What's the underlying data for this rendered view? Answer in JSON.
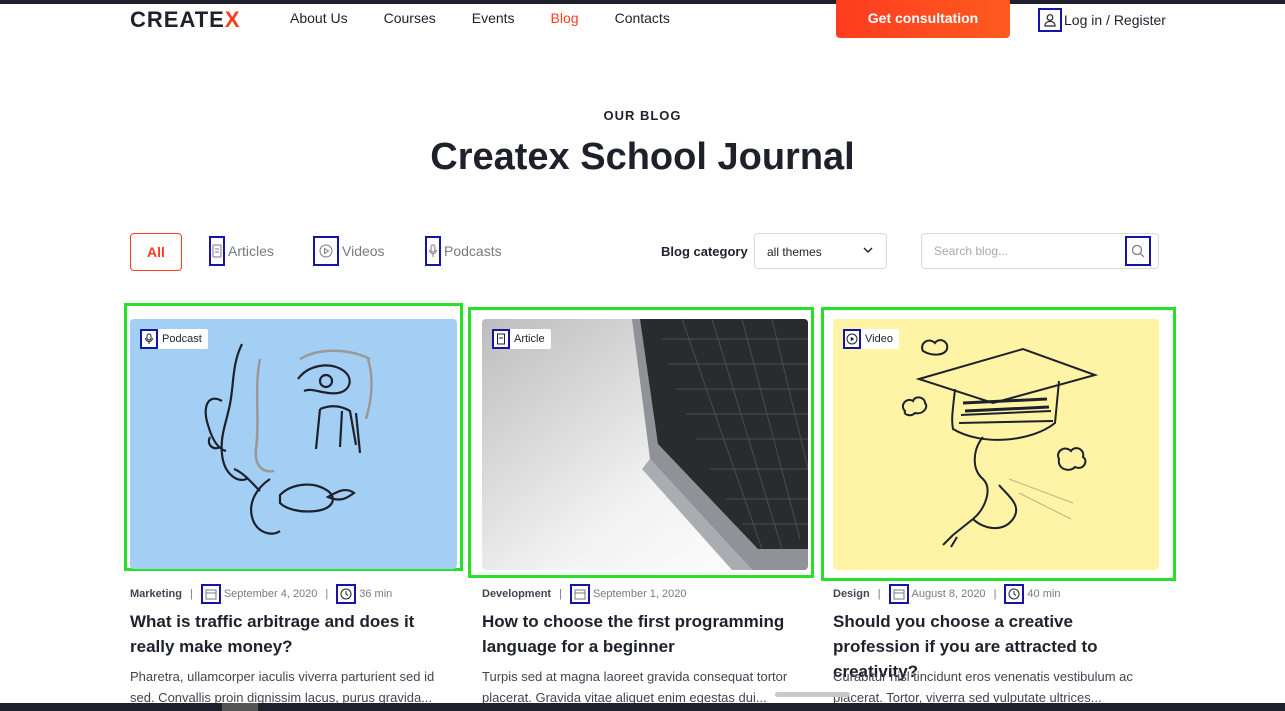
{
  "header": {
    "logo_main": "CREATE",
    "logo_accent": "X",
    "nav": [
      "About Us",
      "Courses",
      "Events",
      "Blog",
      "Contacts"
    ],
    "active_nav": "Blog",
    "consult_button": "Get consultation",
    "login": "Log in / Register",
    "user_icon": "user-icon"
  },
  "hero": {
    "eyebrow": "OUR BLOG",
    "title": "Createx School Journal"
  },
  "filters": {
    "all": "All",
    "articles": "Articles",
    "videos": "Videos",
    "podcasts": "Podcasts",
    "category_label": "Blog category",
    "category_value": "all themes",
    "search_placeholder": "Search blog..."
  },
  "cards": [
    {
      "badge": "Podcast",
      "badge_icon": "microphone-icon",
      "image_bg": "#a3cff5",
      "category": "Marketing",
      "date": "September 4, 2020",
      "duration": "36 min",
      "title": "What is traffic arbitrage and does it really make money?",
      "excerpt": "Pharetra, ullamcorper iaculis viverra parturient sed id sed. Convallis proin dignissim lacus, purus gravida..."
    },
    {
      "badge": "Article",
      "badge_icon": "document-icon",
      "image_bg": "#d9d9d9",
      "category": "Development",
      "date": "September 1, 2020",
      "duration": "",
      "title": "How to choose the first programming language for a beginner",
      "excerpt": "Turpis sed at magna laoreet gravida consequat tortor placerat. Gravida vitae aliquet enim egestas dui..."
    },
    {
      "badge": "Video",
      "badge_icon": "play-icon",
      "image_bg": "#fff4a6",
      "category": "Design",
      "date": "August 8, 2020",
      "duration": "40 min",
      "title": "Should you choose a creative profession if you are attracted to creativity?",
      "excerpt": "Curabitur nisl tincidunt eros venenatis vestibulum ac placerat. Tortor, viverra sed vulputate ultrices..."
    }
  ],
  "colors": {
    "accent": "#ff3c20",
    "dark": "#1e212c",
    "annotation_blue": "#1414a8",
    "annotation_green": "#27e02a"
  }
}
